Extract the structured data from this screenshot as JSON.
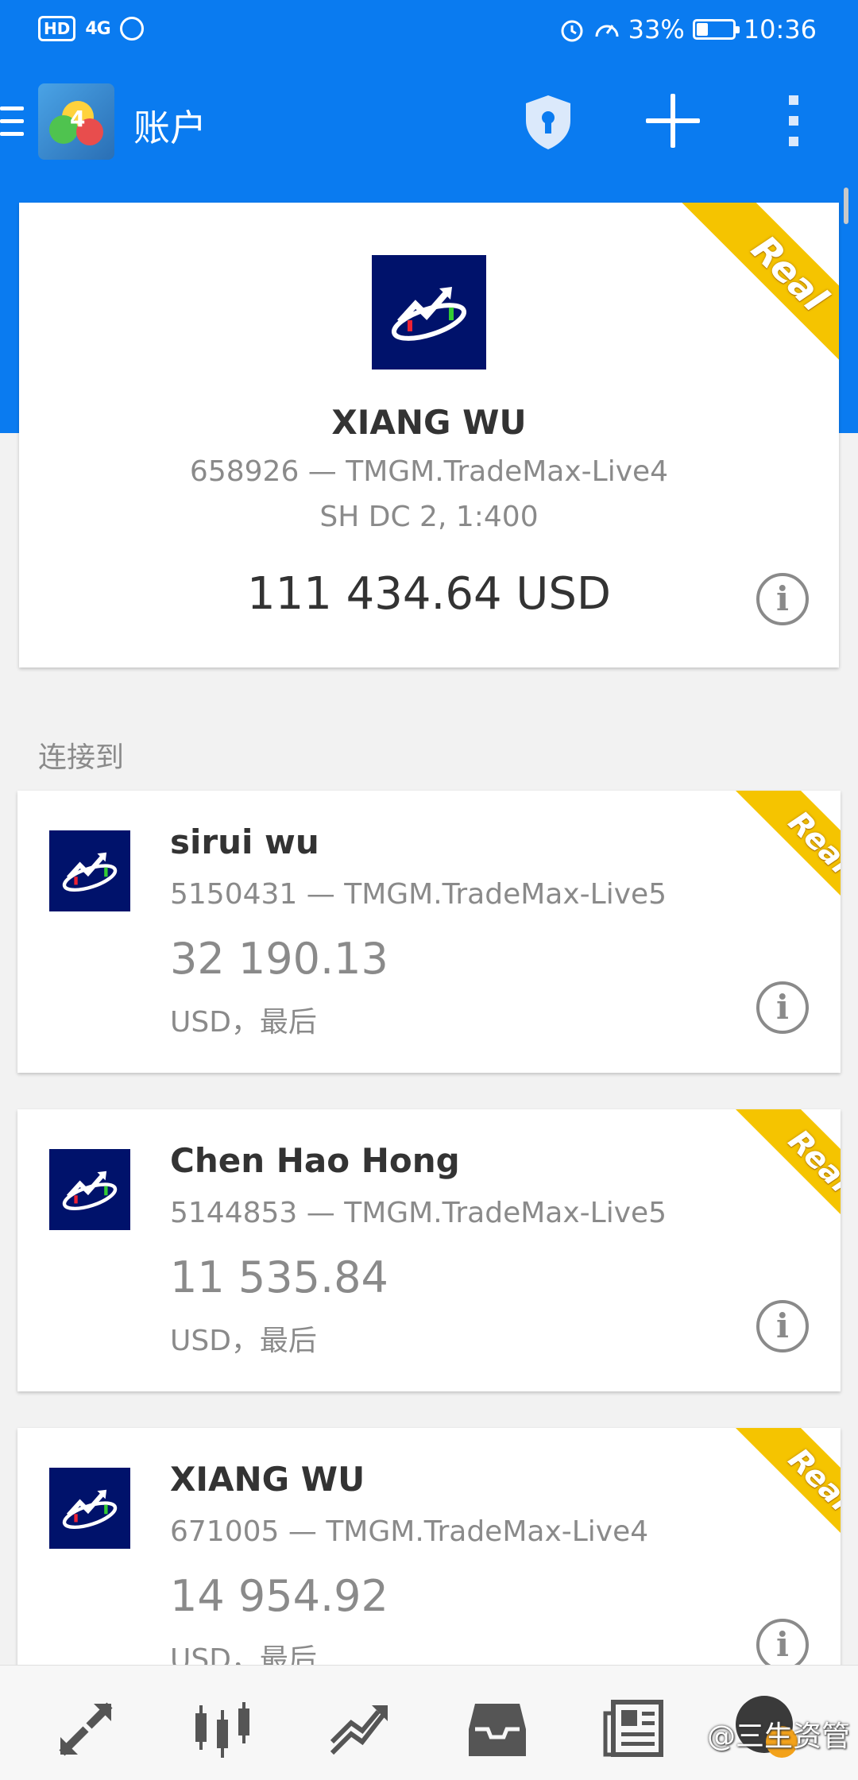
{
  "status_bar": {
    "network": "HD",
    "signal": "4G",
    "battery": "33%",
    "time": "10:36"
  },
  "header": {
    "title": "账户"
  },
  "main_account": {
    "badge": "Real",
    "name": "XIANG WU",
    "number_server": "658926 — TMGM.TradeMax-Live4",
    "group_leverage": "SH DC 2, 1:400",
    "balance": "111 434.64 USD"
  },
  "section": {
    "connect_to": "连接到"
  },
  "accounts": [
    {
      "badge": "Real",
      "name": "sirui wu",
      "number_server": "5150431 — TMGM.TradeMax-Live5",
      "balance": "32 190.13",
      "currency_note": "USD，最后"
    },
    {
      "badge": "Real",
      "name": "Chen Hao Hong",
      "number_server": "5144853 — TMGM.TradeMax-Live5",
      "balance": "11 535.84",
      "currency_note": "USD，最后"
    },
    {
      "badge": "Real",
      "name": "XIANG WU",
      "number_server": "671005 — TMGM.TradeMax-Live4",
      "balance": "14 954.92",
      "currency_note": "USD，最后"
    }
  ],
  "watermark": "@三生资管",
  "icons": [
    "menu-icon",
    "shield-icon",
    "plus-icon",
    "more-icon",
    "info-icon",
    "quotes-icon",
    "chart-icon",
    "trade-icon",
    "history-icon",
    "news-icon"
  ],
  "colors": {
    "primary": "#0a7bf0",
    "badge": "#f5c400",
    "broker": "#00126b"
  }
}
